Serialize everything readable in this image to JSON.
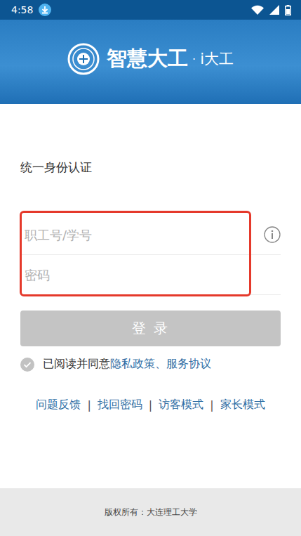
{
  "status_bar": {
    "time": "4:58"
  },
  "header": {
    "logo_title": "智慧大工",
    "separator": "·",
    "logo_subtitle": "i大工"
  },
  "form": {
    "title": "统一身份认证",
    "fields": [
      {
        "placeholder": "职工号/学号",
        "kind": "text"
      },
      {
        "placeholder": "密码",
        "kind": "password"
      }
    ]
  },
  "login_button": {
    "label": "登 录",
    "disabled": true
  },
  "agreement": {
    "checked": false,
    "text": "已阅读并同意",
    "link": "隐私政策、服务协议"
  },
  "links": {
    "items": [
      "问题反馈",
      "找回密码",
      "访客模式",
      "家长模式"
    ],
    "separator": "|"
  },
  "footer": {
    "copyright": "版权所有：大连理工大学"
  }
}
